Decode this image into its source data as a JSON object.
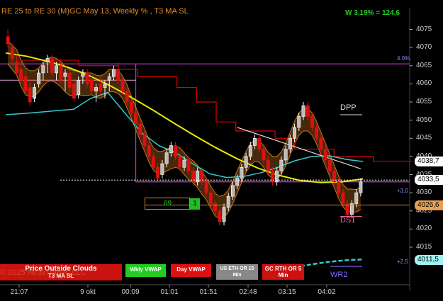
{
  "header": {
    "title": "RE 25 to RE 30 (M)GC May 13, Weekly % , T3 MA SL",
    "stat": "W 3,19% = 124,6"
  },
  "colors": {
    "up_bar": "#ffffff",
    "down_bar": "#dd1111",
    "cloud_band": "#c8761e",
    "slow_ma": "#e8e800",
    "vwap": "#33cccc",
    "red_step": "#dd0000",
    "magenta_box": "#cc33cc",
    "trend_line": "#dddddd",
    "price_axis_text": "#cccccc"
  },
  "chart_data": {
    "type": "candlestick",
    "y_axis": {
      "min": 4007,
      "max": 4079,
      "ticks": [
        4075,
        4070,
        4065,
        4060,
        4055,
        4050,
        4045,
        4040,
        4035,
        4030,
        4025,
        4020,
        4015
      ]
    },
    "x_axis": {
      "tick_labels": [
        "21:07",
        "9 okt",
        "00:09",
        "01:01",
        "01:51",
        "02:48",
        "03:15",
        "04:02"
      ]
    },
    "bars": [
      {
        "o": 4073,
        "h": 4075,
        "l": 4070,
        "c": 4071
      },
      {
        "o": 4070,
        "h": 4071,
        "l": 4066,
        "c": 4067
      },
      {
        "o": 4066,
        "h": 4068,
        "l": 4062,
        "c": 4063
      },
      {
        "o": 4064,
        "h": 4066,
        "l": 4060,
        "c": 4061
      },
      {
        "o": 4062,
        "h": 4064,
        "l": 4057,
        "c": 4058
      },
      {
        "o": 4059,
        "h": 4061,
        "l": 4054,
        "c": 4055
      },
      {
        "o": 4056,
        "h": 4060,
        "l": 4055,
        "c": 4059
      },
      {
        "o": 4060,
        "h": 4064,
        "l": 4059,
        "c": 4063
      },
      {
        "o": 4063,
        "h": 4066,
        "l": 4061,
        "c": 4065
      },
      {
        "o": 4066,
        "h": 4068,
        "l": 4063,
        "c": 4067
      },
      {
        "o": 4067,
        "h": 4068,
        "l": 4062,
        "c": 4063
      },
      {
        "o": 4063,
        "h": 4066,
        "l": 4061,
        "c": 4065
      },
      {
        "o": 4065,
        "h": 4066,
        "l": 4060,
        "c": 4061
      },
      {
        "o": 4062,
        "h": 4064,
        "l": 4058,
        "c": 4063
      },
      {
        "o": 4063,
        "h": 4064,
        "l": 4058,
        "c": 4059
      },
      {
        "o": 4060,
        "h": 4061,
        "l": 4055,
        "c": 4056
      },
      {
        "o": 4057,
        "h": 4062,
        "l": 4056,
        "c": 4061
      },
      {
        "o": 4062,
        "h": 4064,
        "l": 4060,
        "c": 4063
      },
      {
        "o": 4063,
        "h": 4064,
        "l": 4059,
        "c": 4060
      },
      {
        "o": 4061,
        "h": 4062,
        "l": 4057,
        "c": 4058
      },
      {
        "o": 4058,
        "h": 4060,
        "l": 4055,
        "c": 4059
      },
      {
        "o": 4060,
        "h": 4062,
        "l": 4057,
        "c": 4058
      },
      {
        "o": 4059,
        "h": 4061,
        "l": 4056,
        "c": 4060
      },
      {
        "o": 4061,
        "h": 4063,
        "l": 4058,
        "c": 4062
      },
      {
        "o": 4062,
        "h": 4065,
        "l": 4061,
        "c": 4064
      },
      {
        "o": 4064,
        "h": 4066,
        "l": 4060,
        "c": 4061
      },
      {
        "o": 4061,
        "h": 4062,
        "l": 4057,
        "c": 4058
      },
      {
        "o": 4058,
        "h": 4059,
        "l": 4054,
        "c": 4055
      },
      {
        "o": 4055,
        "h": 4056,
        "l": 4051,
        "c": 4052
      },
      {
        "o": 4052,
        "h": 4053,
        "l": 4048,
        "c": 4049
      },
      {
        "o": 4049,
        "h": 4050,
        "l": 4045,
        "c": 4046
      },
      {
        "o": 4046,
        "h": 4047,
        "l": 4042,
        "c": 4043
      },
      {
        "o": 4043,
        "h": 4044,
        "l": 4039,
        "c": 4040
      },
      {
        "o": 4040,
        "h": 4041,
        "l": 4036,
        "c": 4037
      },
      {
        "o": 4037,
        "h": 4038,
        "l": 4033,
        "c": 4034
      },
      {
        "o": 4035,
        "h": 4039,
        "l": 4034,
        "c": 4038
      },
      {
        "o": 4038,
        "h": 4042,
        "l": 4037,
        "c": 4041
      },
      {
        "o": 4041,
        "h": 4044,
        "l": 4040,
        "c": 4043
      },
      {
        "o": 4043,
        "h": 4044,
        "l": 4039,
        "c": 4040
      },
      {
        "o": 4040,
        "h": 4041,
        "l": 4036,
        "c": 4037
      },
      {
        "o": 4037,
        "h": 4040,
        "l": 4036,
        "c": 4039
      },
      {
        "o": 4039,
        "h": 4040,
        "l": 4035,
        "c": 4036
      },
      {
        "o": 4036,
        "h": 4037,
        "l": 4032,
        "c": 4033
      },
      {
        "o": 4033,
        "h": 4037,
        "l": 4032,
        "c": 4036
      },
      {
        "o": 4036,
        "h": 4037,
        "l": 4032,
        "c": 4033
      },
      {
        "o": 4033,
        "h": 4034,
        "l": 4029,
        "c": 4030
      },
      {
        "o": 4030,
        "h": 4031,
        "l": 4026,
        "c": 4027
      },
      {
        "o": 4027,
        "h": 4028,
        "l": 4024,
        "c": 4025
      },
      {
        "o": 4025,
        "h": 4026,
        "l": 4021,
        "c": 4022
      },
      {
        "o": 4022,
        "h": 4027,
        "l": 4021,
        "c": 4026
      },
      {
        "o": 4026,
        "h": 4030,
        "l": 4025,
        "c": 4029
      },
      {
        "o": 4029,
        "h": 4033,
        "l": 4028,
        "c": 4032
      },
      {
        "o": 4032,
        "h": 4035,
        "l": 4031,
        "c": 4034
      },
      {
        "o": 4034,
        "h": 4038,
        "l": 4033,
        "c": 4037
      },
      {
        "o": 4037,
        "h": 4041,
        "l": 4036,
        "c": 4040
      },
      {
        "o": 4040,
        "h": 4044,
        "l": 4039,
        "c": 4043
      },
      {
        "o": 4043,
        "h": 4046,
        "l": 4042,
        "c": 4045
      },
      {
        "o": 4045,
        "h": 4046,
        "l": 4041,
        "c": 4042
      },
      {
        "o": 4042,
        "h": 4043,
        "l": 4038,
        "c": 4039
      },
      {
        "o": 4039,
        "h": 4040,
        "l": 4035,
        "c": 4036
      },
      {
        "o": 4036,
        "h": 4037,
        "l": 4032,
        "c": 4033
      },
      {
        "o": 4033,
        "h": 4037,
        "l": 4032,
        "c": 4036
      },
      {
        "o": 4036,
        "h": 4040,
        "l": 4035,
        "c": 4039
      },
      {
        "o": 4039,
        "h": 4043,
        "l": 4038,
        "c": 4042
      },
      {
        "o": 4042,
        "h": 4046,
        "l": 4041,
        "c": 4045
      },
      {
        "o": 4045,
        "h": 4049,
        "l": 4044,
        "c": 4048
      },
      {
        "o": 4048,
        "h": 4052,
        "l": 4047,
        "c": 4051
      },
      {
        "o": 4051,
        "h": 4055,
        "l": 4050,
        "c": 4054
      },
      {
        "o": 4054,
        "h": 4055,
        "l": 4050,
        "c": 4051
      },
      {
        "o": 4051,
        "h": 4052,
        "l": 4047,
        "c": 4048
      },
      {
        "o": 4048,
        "h": 4049,
        "l": 4044,
        "c": 4045
      },
      {
        "o": 4045,
        "h": 4046,
        "l": 4041,
        "c": 4042
      },
      {
        "o": 4042,
        "h": 4043,
        "l": 4038,
        "c": 4039
      },
      {
        "o": 4039,
        "h": 4040,
        "l": 4035,
        "c": 4036
      },
      {
        "o": 4036,
        "h": 4037,
        "l": 4032,
        "c": 4033
      },
      {
        "o": 4033,
        "h": 4034,
        "l": 4029,
        "c": 4030
      },
      {
        "o": 4030,
        "h": 4031,
        "l": 4026,
        "c": 4027
      },
      {
        "o": 4027,
        "h": 4028,
        "l": 4023,
        "c": 4024
      },
      {
        "o": 4024,
        "h": 4028,
        "l": 4023,
        "c": 4027
      },
      {
        "o": 4027,
        "h": 4031,
        "l": 4026,
        "c": 4030
      },
      {
        "o": 4030,
        "h": 4034,
        "l": 4029,
        "c": 4033
      }
    ],
    "overlays": {
      "slow_ma_y": [
        4068.5,
        4067.6,
        4066.2,
        4064.5,
        4062.2,
        4059.4,
        4056.2,
        4052.8,
        4049.2,
        4045.7,
        4042.4,
        4039.4,
        4036.8,
        4034.8,
        4033.4,
        4032.8,
        4033.0,
        4033.8
      ],
      "vwap_y": [
        4051.5,
        4051.8,
        4052.2,
        4052.6,
        4053.0,
        4056.0,
        4057.6,
        4052.0,
        4046.5,
        4043.0,
        4041.0,
        4038.0,
        4035.2,
        4034.2,
        4034.5,
        4035.5,
        4037.0,
        4038.8,
        4040.0,
        4040.2,
        4039.2,
        4038.6
      ],
      "red_step_y": [
        4066.5,
        4066.5,
        4066.5,
        4065.0,
        4065.0,
        4064.0,
        4062.0,
        4062.0,
        4059.0,
        4055.0,
        4049.5,
        4047.0,
        4047.0,
        4045.0,
        4042.0,
        4042.0,
        4040.0,
        4040.0,
        4038.7,
        4038.7
      ],
      "trend_line": {
        "y_start": 4048.0,
        "y_end": 4036.6
      },
      "white_dotted_level": 4033.5,
      "magenta_box": {
        "top": 4065.5,
        "bottom": 4033.0
      },
      "orange_level": 4026.6
    },
    "price_tags": [
      {
        "value": "4038,7",
        "price": 4038.7,
        "bg": "#ffffff",
        "fg": "#000000"
      },
      {
        "value": "4033,5",
        "price": 4033.5,
        "bg": "#ffffff",
        "fg": "#000000"
      },
      {
        "value": "4026,6",
        "price": 4026.6,
        "bg": "#e8a050",
        "fg": "#000000"
      },
      {
        "value": "4011,5",
        "price": 4011.5,
        "bg": "#9ff2f2",
        "fg": "#000000"
      }
    ],
    "side_labels": [
      {
        "text": "4.0%",
        "price": 4065.5,
        "color": "#8888ff"
      },
      {
        "text": "+3,0",
        "price": 4029.0,
        "color": "#8888ff"
      },
      {
        "text": "+2,5",
        "price": 4009.5,
        "color": "#8888ff"
      }
    ],
    "annotations": {
      "dpp": "DPP",
      "ds1": "DS1",
      "wr2": "WR2",
      "count_left": "69",
      "count_right": "1"
    }
  },
  "bottom_buttons": {
    "price_outside_clouds": "Price Outside Clouds",
    "t3_ma_sl": "T3 MA SL",
    "wkly_vwap": "Wkly VWAP",
    "day_vwap": "Day VWAP",
    "us_eth_or": "US ETH OR 15 Min",
    "gc_rth_or": "GC RTH OR 5 Min"
  },
  "watermark": "© 2025 NinjaTrader, LLC"
}
